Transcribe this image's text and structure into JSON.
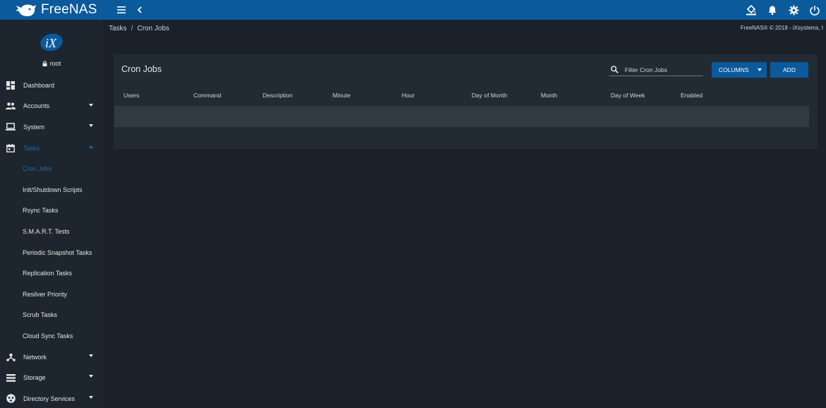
{
  "app": {
    "brand": "FreeNAS"
  },
  "topbar": {
    "left_icons": [
      "menu-icon",
      "chevron-left-icon"
    ],
    "right_icons": [
      "theme-icon",
      "bell-icon",
      "gear-icon",
      "power-icon"
    ]
  },
  "sidebar": {
    "user": "root",
    "items": [
      {
        "label": "Dashboard",
        "icon": "dashboard-icon",
        "expandable": false
      },
      {
        "label": "Accounts",
        "icon": "people-icon",
        "expandable": true
      },
      {
        "label": "System",
        "icon": "laptop-icon",
        "expandable": true
      },
      {
        "label": "Tasks",
        "icon": "calendar-icon",
        "expandable": true,
        "expanded": true
      },
      {
        "label": "Network",
        "icon": "network-icon",
        "expandable": true
      },
      {
        "label": "Storage",
        "icon": "storage-icon",
        "expandable": true
      },
      {
        "label": "Directory Services",
        "icon": "directory-icon",
        "expandable": true
      }
    ],
    "task_subitems": [
      "Cron Jobs",
      "Init/Shutdown Scripts",
      "Rsync Tasks",
      "S.M.A.R.T. Tests",
      "Periodic Snapshot Tasks",
      "Replication Tasks",
      "Resilver Priority",
      "Scrub Tasks",
      "Cloud Sync Tasks"
    ]
  },
  "breadcrumb": {
    "parent": "Tasks",
    "separator": "/",
    "current": "Cron Jobs"
  },
  "copyright": "FreeNAS® © 2018 - iXsystems, I",
  "card": {
    "title": "Cron Jobs",
    "filter_placeholder": "Filter Cron Jobs",
    "columns_label": "COLUMNS",
    "add_label": "ADD",
    "columns": [
      "Users",
      "Command",
      "Description",
      "Minute",
      "Hour",
      "Day of Month",
      "Month",
      "Day of Week",
      "Enabled"
    ]
  },
  "colors": {
    "accent": "#0a5a9c",
    "active": "#1a6db5",
    "sidebar": "#1d252e",
    "card": "#222b34",
    "background": "#1b2129"
  }
}
